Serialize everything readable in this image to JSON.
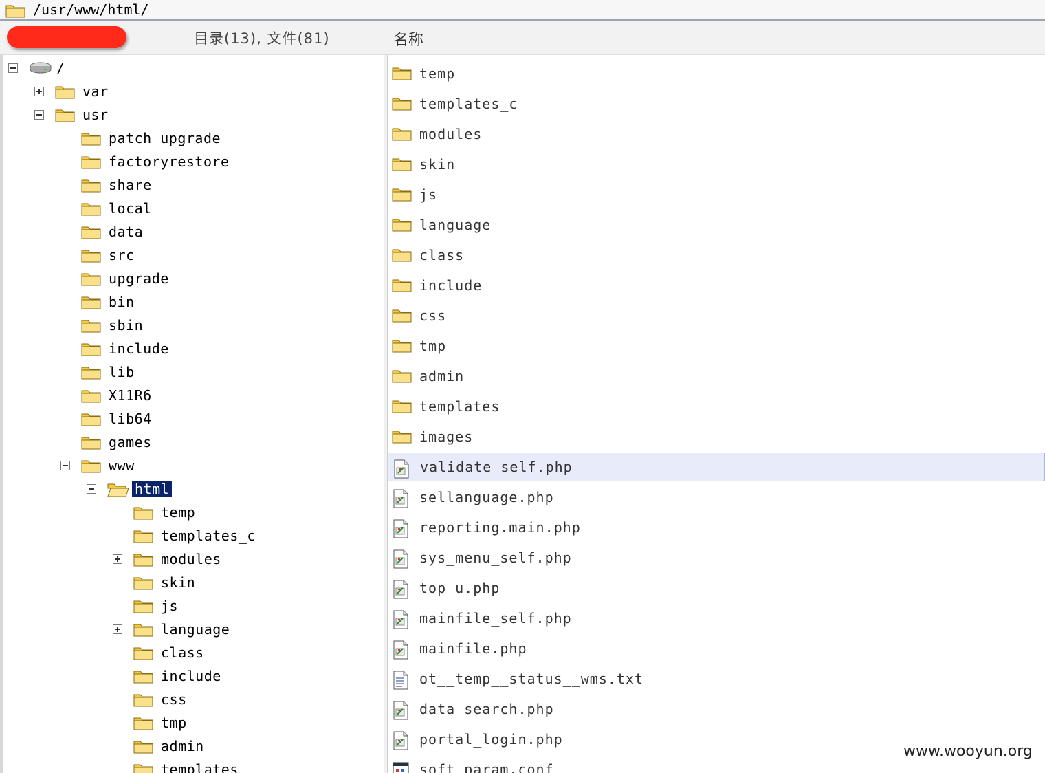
{
  "path_bar": {
    "path": "/usr/www/html/"
  },
  "header": {
    "counts": "目录(13), 文件(81)",
    "name_column": "名称"
  },
  "tree": [
    {
      "label": "/",
      "depth": 0,
      "icon": "drive-icon",
      "expander": "minus"
    },
    {
      "label": "var",
      "depth": 1,
      "icon": "folder-icon",
      "expander": "plus"
    },
    {
      "label": "usr",
      "depth": 1,
      "icon": "folder-icon",
      "expander": "minus"
    },
    {
      "label": "patch_upgrade",
      "depth": 2,
      "icon": "folder-icon",
      "expander": ""
    },
    {
      "label": "factoryrestore",
      "depth": 2,
      "icon": "folder-icon",
      "expander": ""
    },
    {
      "label": "share",
      "depth": 2,
      "icon": "folder-icon",
      "expander": ""
    },
    {
      "label": "local",
      "depth": 2,
      "icon": "folder-icon",
      "expander": ""
    },
    {
      "label": "data",
      "depth": 2,
      "icon": "folder-icon",
      "expander": ""
    },
    {
      "label": "src",
      "depth": 2,
      "icon": "folder-icon",
      "expander": ""
    },
    {
      "label": "upgrade",
      "depth": 2,
      "icon": "folder-icon",
      "expander": ""
    },
    {
      "label": "bin",
      "depth": 2,
      "icon": "folder-icon",
      "expander": ""
    },
    {
      "label": "sbin",
      "depth": 2,
      "icon": "folder-icon",
      "expander": ""
    },
    {
      "label": "include",
      "depth": 2,
      "icon": "folder-icon",
      "expander": ""
    },
    {
      "label": "lib",
      "depth": 2,
      "icon": "folder-icon",
      "expander": ""
    },
    {
      "label": "X11R6",
      "depth": 2,
      "icon": "folder-icon",
      "expander": ""
    },
    {
      "label": "lib64",
      "depth": 2,
      "icon": "folder-icon",
      "expander": ""
    },
    {
      "label": "games",
      "depth": 2,
      "icon": "folder-icon",
      "expander": ""
    },
    {
      "label": "www",
      "depth": 2,
      "icon": "folder-icon",
      "expander": "minus"
    },
    {
      "label": "html",
      "depth": 3,
      "icon": "open-folder-icon",
      "expander": "minus",
      "selected": true
    },
    {
      "label": "temp",
      "depth": 4,
      "icon": "folder-icon",
      "expander": ""
    },
    {
      "label": "templates_c",
      "depth": 4,
      "icon": "folder-icon",
      "expander": ""
    },
    {
      "label": "modules",
      "depth": 4,
      "icon": "folder-icon",
      "expander": "plus"
    },
    {
      "label": "skin",
      "depth": 4,
      "icon": "folder-icon",
      "expander": ""
    },
    {
      "label": "js",
      "depth": 4,
      "icon": "folder-icon",
      "expander": ""
    },
    {
      "label": "language",
      "depth": 4,
      "icon": "folder-icon",
      "expander": "plus"
    },
    {
      "label": "class",
      "depth": 4,
      "icon": "folder-icon",
      "expander": ""
    },
    {
      "label": "include",
      "depth": 4,
      "icon": "folder-icon",
      "expander": ""
    },
    {
      "label": "css",
      "depth": 4,
      "icon": "folder-icon",
      "expander": ""
    },
    {
      "label": "tmp",
      "depth": 4,
      "icon": "folder-icon",
      "expander": ""
    },
    {
      "label": "admin",
      "depth": 4,
      "icon": "folder-icon",
      "expander": ""
    },
    {
      "label": "templates",
      "depth": 4,
      "icon": "folder-icon",
      "expander": ""
    }
  ],
  "files": [
    {
      "name": "temp",
      "icon": "folder-icon"
    },
    {
      "name": "templates_c",
      "icon": "folder-icon"
    },
    {
      "name": "modules",
      "icon": "folder-icon"
    },
    {
      "name": "skin",
      "icon": "folder-icon"
    },
    {
      "name": "js",
      "icon": "folder-icon"
    },
    {
      "name": "language",
      "icon": "folder-icon"
    },
    {
      "name": "class",
      "icon": "folder-icon"
    },
    {
      "name": "include",
      "icon": "folder-icon"
    },
    {
      "name": "css",
      "icon": "folder-icon"
    },
    {
      "name": "tmp",
      "icon": "folder-icon"
    },
    {
      "name": "admin",
      "icon": "folder-icon"
    },
    {
      "name": "templates",
      "icon": "folder-icon"
    },
    {
      "name": "images",
      "icon": "folder-icon"
    },
    {
      "name": "validate_self.php",
      "icon": "php-file-icon",
      "selected": true
    },
    {
      "name": "sellanguage.php",
      "icon": "php-file-icon"
    },
    {
      "name": "reporting.main.php",
      "icon": "php-file-icon"
    },
    {
      "name": "sys_menu_self.php",
      "icon": "php-file-icon"
    },
    {
      "name": "top_u.php",
      "icon": "php-file-icon"
    },
    {
      "name": "mainfile_self.php",
      "icon": "php-file-icon"
    },
    {
      "name": "mainfile.php",
      "icon": "php-file-icon"
    },
    {
      "name": "ot__temp__status__wms.txt",
      "icon": "text-file-icon"
    },
    {
      "name": "data_search.php",
      "icon": "php-file-icon"
    },
    {
      "name": "portal_login.php",
      "icon": "php-file-icon"
    },
    {
      "name": "soft_param.conf",
      "icon": "config-file-icon"
    }
  ],
  "watermark": "www.wooyun.org",
  "colors": {
    "selection": "#0a246a",
    "folder": "#f5c842",
    "redacted": "#ff2a1a"
  }
}
